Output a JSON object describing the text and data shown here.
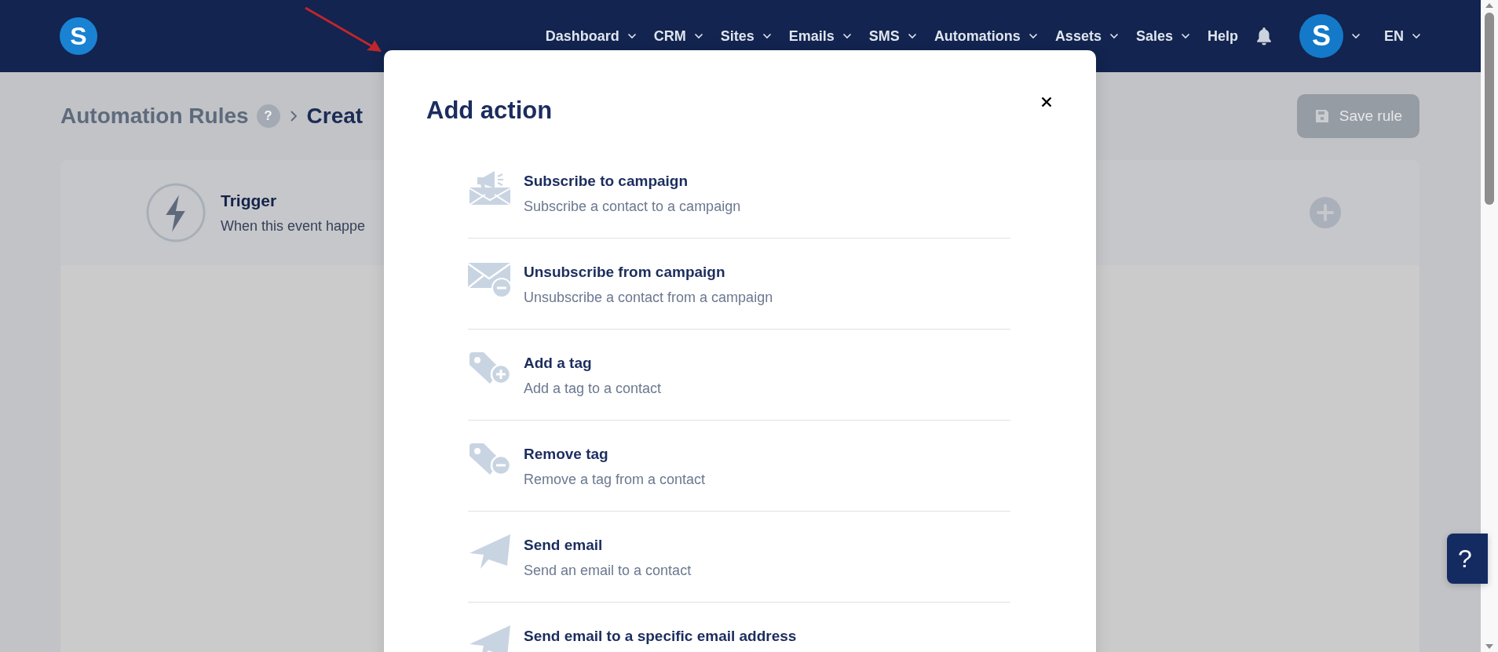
{
  "logo": "S",
  "nav": {
    "items": [
      {
        "label": "Dashboard",
        "dropdown": true
      },
      {
        "label": "CRM",
        "dropdown": true
      },
      {
        "label": "Sites",
        "dropdown": true
      },
      {
        "label": "Emails",
        "dropdown": true
      },
      {
        "label": "SMS",
        "dropdown": true
      },
      {
        "label": "Automations",
        "dropdown": true
      },
      {
        "label": "Assets",
        "dropdown": true
      },
      {
        "label": "Sales",
        "dropdown": true
      },
      {
        "label": "Help",
        "dropdown": false
      }
    ],
    "avatar": "S",
    "language": "EN"
  },
  "breadcrumb": {
    "parent": "Automation Rules",
    "help_mark": "?",
    "current": "Creat"
  },
  "save_button": {
    "label": "Save rule",
    "disabled": true
  },
  "trigger": {
    "title": "Trigger",
    "description": "When this event happe"
  },
  "modal": {
    "title": "Add action",
    "actions": [
      {
        "kind": "megaphone-mail",
        "title": "Subscribe to campaign",
        "description": "Subscribe a contact to a campaign"
      },
      {
        "kind": "mail-minus",
        "title": "Unsubscribe from campaign",
        "description": "Unsubscribe a contact from a campaign"
      },
      {
        "kind": "tag-plus",
        "title": "Add a tag",
        "description": "Add a tag to a contact"
      },
      {
        "kind": "tag-minus",
        "title": "Remove tag",
        "description": "Remove a tag from a contact"
      },
      {
        "kind": "paper-plane",
        "title": "Send email",
        "description": "Send an email to a contact"
      },
      {
        "kind": "paper-plane",
        "title": "Send email to a specific email address"
      }
    ]
  },
  "help_button": "?"
}
